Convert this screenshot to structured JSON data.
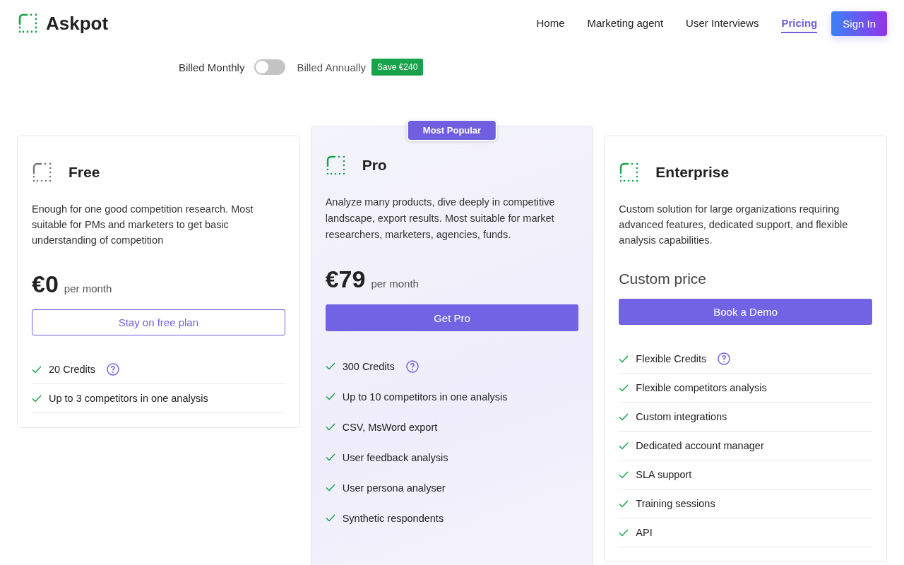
{
  "brand": "Askpot",
  "nav": [
    {
      "label": "Home",
      "selected": false
    },
    {
      "label": "Marketing agent",
      "selected": false
    },
    {
      "label": "User Interviews",
      "selected": false
    },
    {
      "label": "Pricing",
      "selected": true
    }
  ],
  "sign_in": "Sign In",
  "billing": {
    "monthly": "Billed Monthly",
    "annually": "Billed Annually",
    "on": false,
    "save_badge": "Save €240"
  },
  "plans": [
    {
      "name": "Free",
      "icon_active": false,
      "featured": false,
      "description": "Enough for one good competition research. Most suitable for PMs and marketers to get basic understanding of competition",
      "price": "€0",
      "period": "per month",
      "button": {
        "label": "Stay on free plan",
        "kind": "outline"
      },
      "features": [
        {
          "text": "20 Credits",
          "help": true
        },
        {
          "text": "Up to 3 competitors in one analysis",
          "help": false
        }
      ]
    },
    {
      "name": "Pro",
      "icon_active": true,
      "featured": true,
      "badge": "Most Popular",
      "description": "Analyze many products, dive deeply in competitive landscape, export results. Most suitable for market researchers, marketers, agencies, funds.",
      "price": "€79",
      "period": "per month",
      "button": {
        "label": "Get Pro",
        "kind": "filled"
      },
      "features": [
        {
          "text": "300 Credits",
          "help": true
        },
        {
          "text": "Up to 10 competitors in one analysis",
          "help": false
        },
        {
          "text": "CSV, MsWord export",
          "help": false
        },
        {
          "text": "User feedback analysis",
          "help": false
        },
        {
          "text": "User persona analyser",
          "help": false
        },
        {
          "text": "Synthetic respondents",
          "help": false
        }
      ]
    },
    {
      "name": "Enterprise",
      "icon_active": true,
      "featured": false,
      "description": "Custom solution for large organizations requiring advanced features, dedicated support, and flexible analysis capabilities.",
      "price": "Custom price",
      "button": {
        "label": "Book a Demo",
        "kind": "filled"
      },
      "features": [
        {
          "text": "Flexible Credits",
          "help": true
        },
        {
          "text": "Flexible competitors analysis",
          "help": false
        },
        {
          "text": "Custom integrations",
          "help": false
        },
        {
          "text": "Dedicated account manager",
          "help": false
        },
        {
          "text": "SLA support",
          "help": false
        },
        {
          "text": "Training sessions",
          "help": false
        },
        {
          "text": "API",
          "help": false
        }
      ]
    }
  ]
}
